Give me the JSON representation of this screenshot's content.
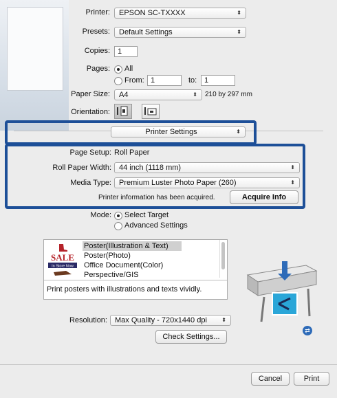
{
  "print_dialog": {
    "printer": {
      "label": "Printer:",
      "value": "EPSON SC-TXXXX"
    },
    "presets": {
      "label": "Presets:",
      "value": "Default Settings"
    },
    "copies": {
      "label": "Copies:",
      "value": "1"
    },
    "pages": {
      "label": "Pages:",
      "all_label": "All",
      "from_label": "From:",
      "from_value": "1",
      "to_label": "to:",
      "to_value": "1",
      "selected": "All"
    },
    "paper_size": {
      "label": "Paper Size:",
      "value": "A4",
      "dimensions": "210 by 297 mm"
    },
    "orientation": {
      "label": "Orientation:",
      "options": [
        "portrait",
        "landscape"
      ],
      "selected": "portrait"
    },
    "panel_selector": {
      "value": "Printer Settings"
    },
    "page_setup": {
      "label": "Page Setup:",
      "value": "Roll Paper"
    },
    "roll_paper_width": {
      "label": "Roll Paper Width:",
      "value": "44 inch (1118 mm)"
    },
    "media_type": {
      "label": "Media Type:",
      "value": "Premium Luster Photo Paper (260)"
    },
    "printer_info": {
      "text": "Printer information has been acquired.",
      "button_label": "Acquire Info"
    },
    "mode": {
      "label": "Mode:",
      "options": [
        "Select Target",
        "Advanced Settings"
      ],
      "selected": "Select Target"
    },
    "target": {
      "items": [
        "Poster(Illustration & Text)",
        "Poster(Photo)",
        "Office Document(Color)",
        "Perspective/GIS"
      ],
      "selected_index": 0,
      "description": "Print posters with illustrations and texts vividly.",
      "thumbnail_text": {
        "sale": "SALE",
        "store": "In Store Now"
      }
    },
    "resolution": {
      "label": "Resolution:",
      "value": "Max Quality - 720x1440 dpi"
    },
    "check_settings_label": "Check Settings...",
    "cancel_label": "Cancel",
    "print_label": "Print",
    "colors": {
      "highlight": "#1d4f98",
      "dialog_bg": "#ececec"
    }
  }
}
